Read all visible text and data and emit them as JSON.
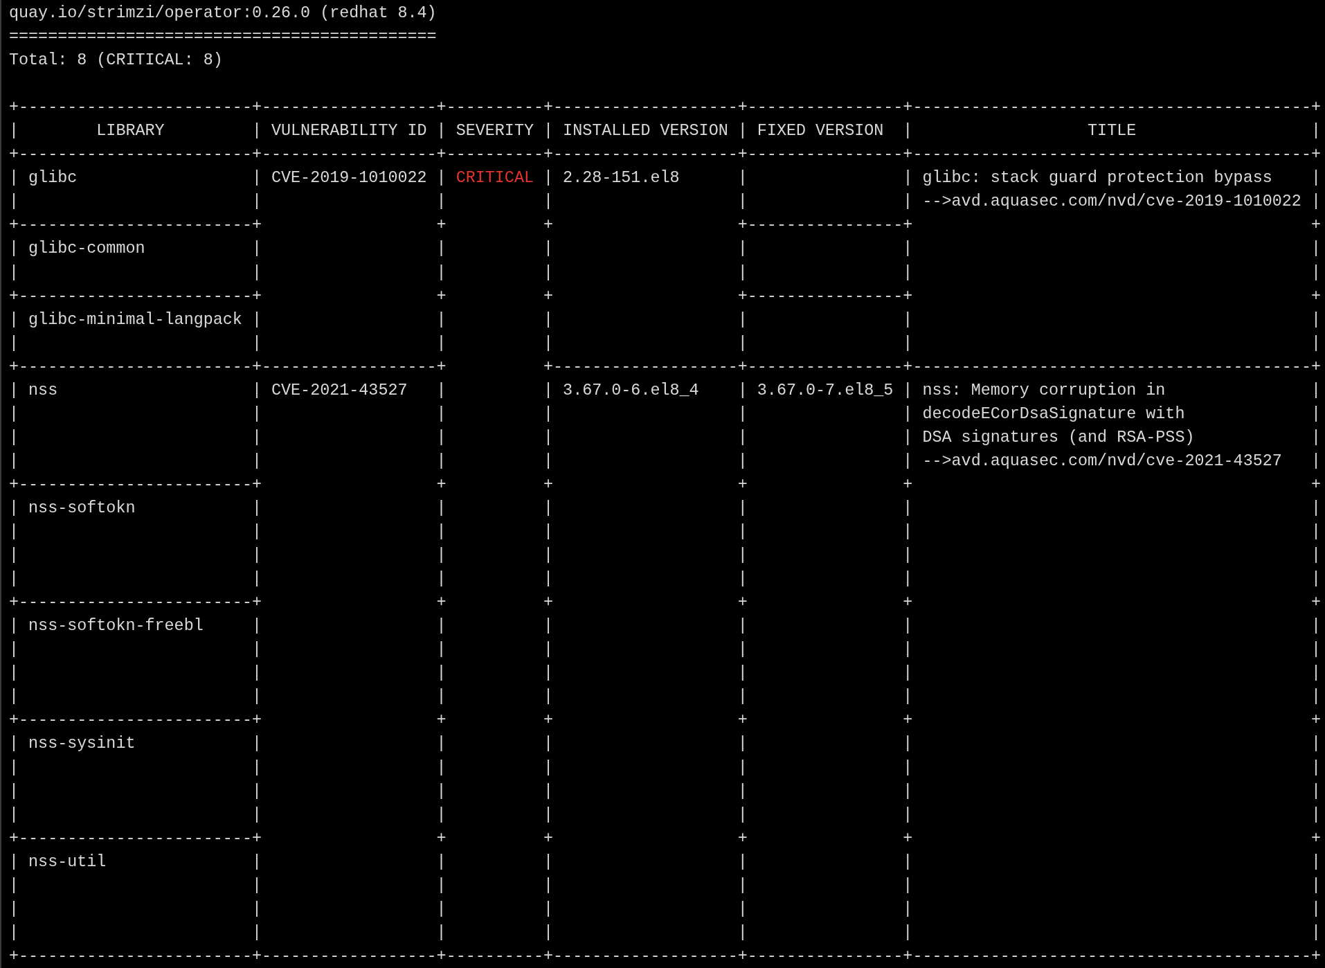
{
  "terminal": {
    "header_lines": [
      "quay.io/strimzi/operator:0.26.0 (redhat 8.4)",
      "============================================",
      "Total: 8 (CRITICAL: 8)"
    ],
    "table_lines": [
      {
        "parts": [
          {
            "kind": "plain",
            "text": "+------------------------+------------------+----------+-------------------+----------------+-----------------------------------------+"
          }
        ]
      },
      {
        "parts": [
          {
            "kind": "plain",
            "text": "|        LIBRARY         | VULNERABILITY ID | SEVERITY | INSTALLED VERSION | FIXED VERSION  |                  TITLE                  |"
          }
        ]
      },
      {
        "parts": [
          {
            "kind": "plain",
            "text": "+------------------------+------------------+----------+-------------------+----------------+-----------------------------------------+"
          }
        ]
      },
      {
        "parts": [
          {
            "kind": "plain",
            "text": "| glibc                  | CVE-2019-1010022 | "
          },
          {
            "kind": "critical",
            "text": "CRITICAL"
          },
          {
            "kind": "plain",
            "text": " | 2.28-151.el8      |                | glibc: stack guard protection bypass    |"
          }
        ]
      },
      {
        "parts": [
          {
            "kind": "plain",
            "text": "|                        |                  |          |                   |                | -->avd.aquasec.com/nvd/cve-2019-1010022 |"
          }
        ]
      },
      {
        "parts": [
          {
            "kind": "plain",
            "text": "+------------------------+                  +          +                   +----------------+                                         +"
          }
        ]
      },
      {
        "parts": [
          {
            "kind": "plain",
            "text": "| glibc-common           |                  |          |                   |                |                                         |"
          }
        ]
      },
      {
        "parts": [
          {
            "kind": "plain",
            "text": "|                        |                  |          |                   |                |                                         |"
          }
        ]
      },
      {
        "parts": [
          {
            "kind": "plain",
            "text": "+------------------------+                  +          +                   +----------------+                                         +"
          }
        ]
      },
      {
        "parts": [
          {
            "kind": "plain",
            "text": "| glibc-minimal-langpack |                  |          |                   |                |                                         |"
          }
        ]
      },
      {
        "parts": [
          {
            "kind": "plain",
            "text": "|                        |                  |          |                   |                |                                         |"
          }
        ]
      },
      {
        "parts": [
          {
            "kind": "plain",
            "text": "+------------------------+------------------+          +-------------------+----------------+-----------------------------------------+"
          }
        ]
      },
      {
        "parts": [
          {
            "kind": "plain",
            "text": "| nss                    | CVE-2021-43527   |          | 3.67.0-6.el8_4    | 3.67.0-7.el8_5 | nss: Memory corruption in               |"
          }
        ]
      },
      {
        "parts": [
          {
            "kind": "plain",
            "text": "|                        |                  |          |                   |                | decodeECorDsaSignature with             |"
          }
        ]
      },
      {
        "parts": [
          {
            "kind": "plain",
            "text": "|                        |                  |          |                   |                | DSA signatures (and RSA-PSS)            |"
          }
        ]
      },
      {
        "parts": [
          {
            "kind": "plain",
            "text": "|                        |                  |          |                   |                | -->avd.aquasec.com/nvd/cve-2021-43527   |"
          }
        ]
      },
      {
        "parts": [
          {
            "kind": "plain",
            "text": "+------------------------+                  +          +                   +                +                                         +"
          }
        ]
      },
      {
        "parts": [
          {
            "kind": "plain",
            "text": "| nss-softokn            |                  |          |                   |                |                                         |"
          }
        ]
      },
      {
        "parts": [
          {
            "kind": "plain",
            "text": "|                        |                  |          |                   |                |                                         |"
          }
        ]
      },
      {
        "parts": [
          {
            "kind": "plain",
            "text": "|                        |                  |          |                   |                |                                         |"
          }
        ]
      },
      {
        "parts": [
          {
            "kind": "plain",
            "text": "|                        |                  |          |                   |                |                                         |"
          }
        ]
      },
      {
        "parts": [
          {
            "kind": "plain",
            "text": "+------------------------+                  +          +                   +                +                                         +"
          }
        ]
      },
      {
        "parts": [
          {
            "kind": "plain",
            "text": "| nss-softokn-freebl     |                  |          |                   |                |                                         |"
          }
        ]
      },
      {
        "parts": [
          {
            "kind": "plain",
            "text": "|                        |                  |          |                   |                |                                         |"
          }
        ]
      },
      {
        "parts": [
          {
            "kind": "plain",
            "text": "|                        |                  |          |                   |                |                                         |"
          }
        ]
      },
      {
        "parts": [
          {
            "kind": "plain",
            "text": "|                        |                  |          |                   |                |                                         |"
          }
        ]
      },
      {
        "parts": [
          {
            "kind": "plain",
            "text": "+------------------------+                  +          +                   +                +                                         +"
          }
        ]
      },
      {
        "parts": [
          {
            "kind": "plain",
            "text": "| nss-sysinit            |                  |          |                   |                |                                         |"
          }
        ]
      },
      {
        "parts": [
          {
            "kind": "plain",
            "text": "|                        |                  |          |                   |                |                                         |"
          }
        ]
      },
      {
        "parts": [
          {
            "kind": "plain",
            "text": "|                        |                  |          |                   |                |                                         |"
          }
        ]
      },
      {
        "parts": [
          {
            "kind": "plain",
            "text": "|                        |                  |          |                   |                |                                         |"
          }
        ]
      },
      {
        "parts": [
          {
            "kind": "plain",
            "text": "+------------------------+                  +          +                   +                +                                         +"
          }
        ]
      },
      {
        "parts": [
          {
            "kind": "plain",
            "text": "| nss-util               |                  |          |                   |                |                                         |"
          }
        ]
      },
      {
        "parts": [
          {
            "kind": "plain",
            "text": "|                        |                  |          |                   |                |                                         |"
          }
        ]
      },
      {
        "parts": [
          {
            "kind": "plain",
            "text": "|                        |                  |          |                   |                |                                         |"
          }
        ]
      },
      {
        "parts": [
          {
            "kind": "plain",
            "text": "|                        |                  |          |                   |                |                                         |"
          }
        ]
      },
      {
        "parts": [
          {
            "kind": "plain",
            "text": "+------------------------+------------------+----------+-------------------+----------------+-----------------------------------------+"
          }
        ]
      }
    ]
  }
}
